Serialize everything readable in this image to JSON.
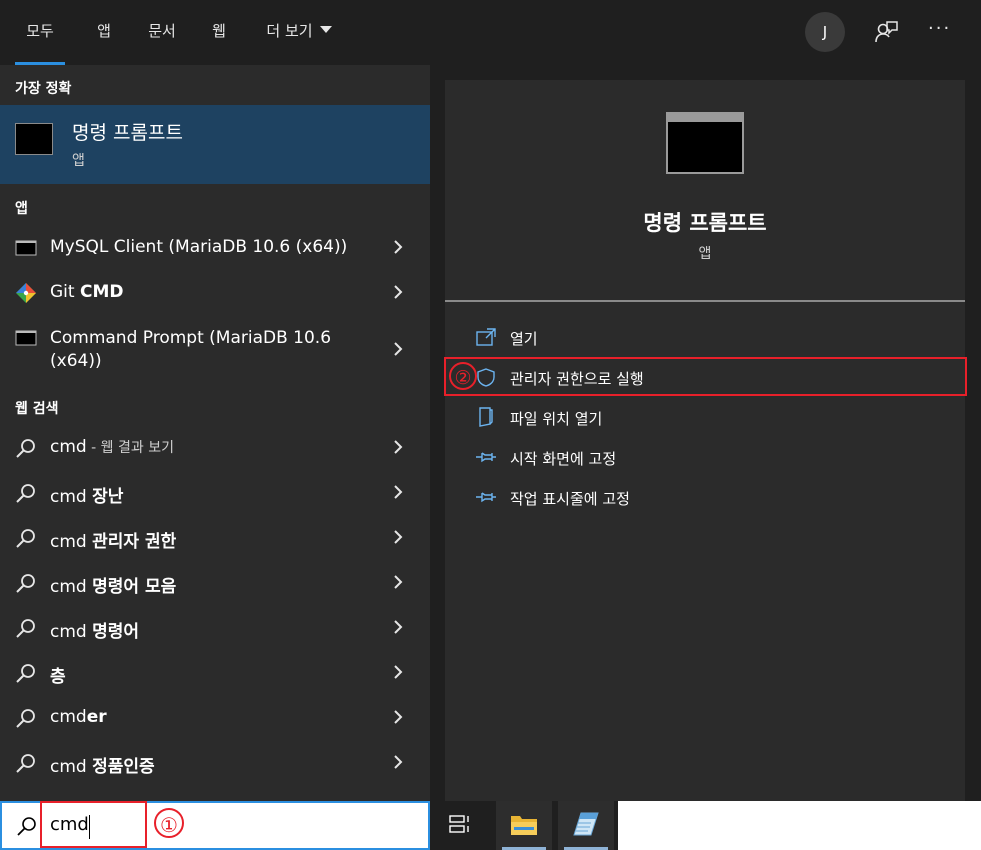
{
  "tabs": [
    {
      "label": "모두"
    },
    {
      "label": "앱"
    },
    {
      "label": "문서"
    },
    {
      "label": "웹"
    },
    {
      "label": "더 보기"
    }
  ],
  "user_avatar": "J",
  "more_dots": "···",
  "best_match": {
    "section": "가장 정확",
    "title": "명령 프롬프트",
    "subtitle": "앱"
  },
  "apps_section": {
    "label": "앱",
    "items": [
      {
        "label_plain": "MySQL Client (MariaDB 10.6 (x64))",
        "icon": "terminal-icon"
      },
      {
        "label_plain": "Git ",
        "label_bold": "CMD",
        "icon": "git-icon"
      },
      {
        "label_line1": "Command Prompt (MariaDB 10.6",
        "label_line2": "(x64))",
        "icon": "terminal-icon"
      }
    ]
  },
  "web_section": {
    "label": "웹 검색",
    "items": [
      {
        "plain": "cmd",
        "bold": "",
        "suffix": " - 웹 결과 보기"
      },
      {
        "plain": "cmd ",
        "bold": "장난",
        "suffix": ""
      },
      {
        "plain": "cmd ",
        "bold": "관리자 권한",
        "suffix": ""
      },
      {
        "plain": "cmd ",
        "bold": "명령어 모음",
        "suffix": ""
      },
      {
        "plain": "cmd ",
        "bold": "명령어",
        "suffix": ""
      },
      {
        "plain": "",
        "bold": "층",
        "suffix": ""
      },
      {
        "plain": "cmd",
        "bold": "er",
        "suffix": ""
      },
      {
        "plain": "cmd ",
        "bold": "정품인증",
        "suffix": ""
      }
    ]
  },
  "detail": {
    "title": "명령 프롬프트",
    "subtitle": "앱",
    "actions": [
      {
        "label": "열기",
        "icon": "open-icon"
      },
      {
        "label": "관리자 권한으로 실행",
        "icon": "shield-icon"
      },
      {
        "label": "파일 위치 열기",
        "icon": "file-location-icon"
      },
      {
        "label": "시작 화면에 고정",
        "icon": "pin-icon"
      },
      {
        "label": "작업 표시줄에 고정",
        "icon": "pin-icon"
      }
    ]
  },
  "search": {
    "value": "cmd"
  },
  "annotations": {
    "step1": "①",
    "step2": "②"
  },
  "colors": {
    "accent": "#2b8fe0",
    "highlight_red": "#e8202a",
    "selected_bg": "#1e4261"
  }
}
